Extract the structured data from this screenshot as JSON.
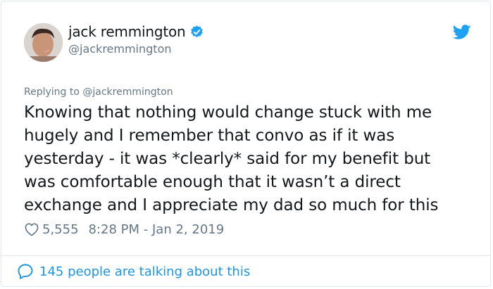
{
  "author": {
    "display_name": "jack remmington",
    "handle": "@jackremmington",
    "verified": true,
    "avatar_icon": "profile-photo"
  },
  "reply": {
    "text": "Replying to @jackremmington"
  },
  "tweet": {
    "lines": [
      "Knowing that nothing would change stuck with me",
      "hugely and I remember that convo as if it was",
      "yesterday - it was *clearly* said for my benefit but",
      "was comfortable enough that it wasn’t a direct",
      "exchange and I appreciate my dad so much for this"
    ],
    "likes": "5,555",
    "timestamp": "8:28 PM - Jan 2, 2019"
  },
  "footer": {
    "conversation_text": "145 people are talking about this"
  },
  "colors": {
    "text": "#14171a",
    "muted": "#657786",
    "accent": "#1b95e0",
    "verified": "#1da1f2",
    "border": "#e1e8ed"
  },
  "icons": {
    "verified": "verified-badge-icon",
    "brand": "twitter-bird-icon",
    "like": "heart-outline-icon",
    "reply": "speech-bubble-icon"
  }
}
